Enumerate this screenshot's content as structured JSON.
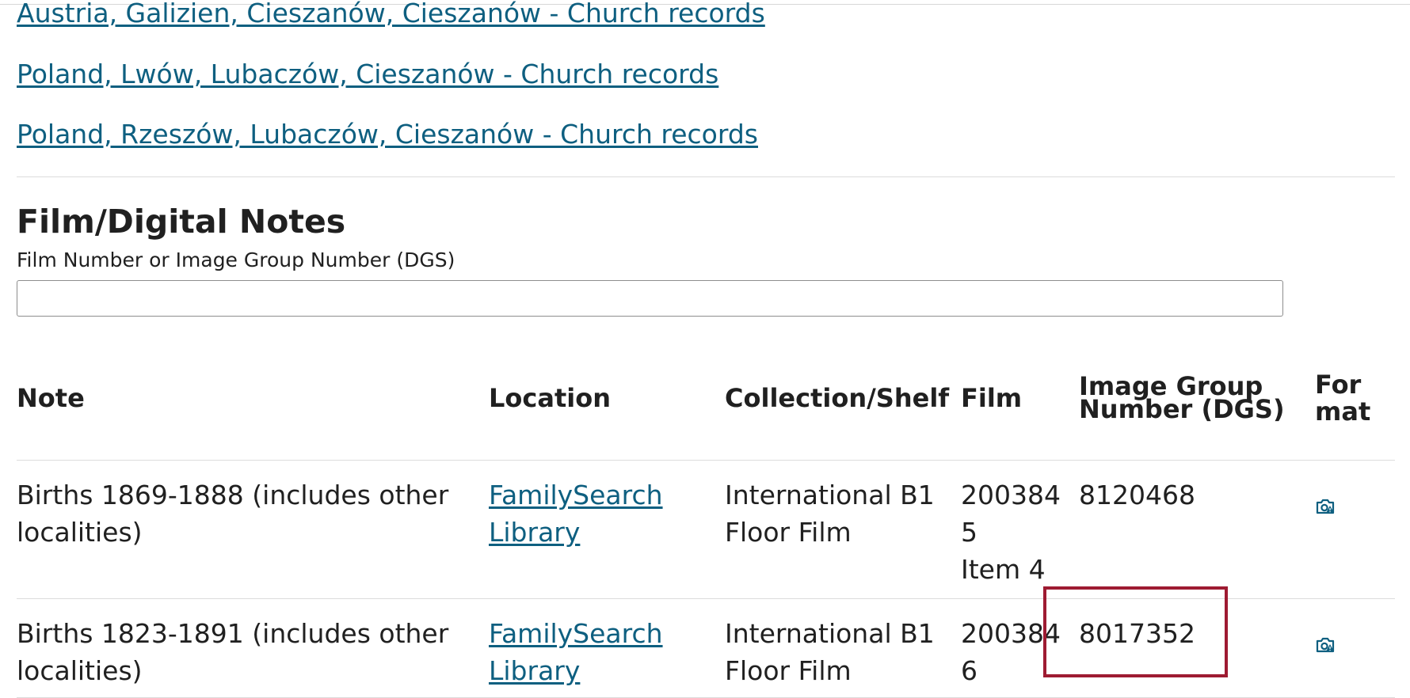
{
  "related_places": [
    {
      "label": "Austria, Galizien, Cieszanów, Cieszanów - Church records"
    },
    {
      "label": "Poland, Lwów, Lubaczów, Cieszanów - Church records"
    },
    {
      "label": "Poland, Rzeszów, Lubaczów, Cieszanów - Church records"
    }
  ],
  "film_notes": {
    "title": "Film/Digital Notes",
    "filter_label": "Film Number or Image Group Number (DGS)",
    "filter_value": "",
    "filter_placeholder": "",
    "columns": {
      "note": "Note",
      "location": "Location",
      "collection": "Collection/Shelf",
      "film": "Film",
      "dgs": "Image Group Number (DGS)",
      "format": "Format"
    },
    "rows": [
      {
        "note": "Births 1869-1888 (includes other localities)",
        "location": "FamilySearch Library",
        "collection": "International B1 Floor Film",
        "film": "2003845",
        "item": "Item 4",
        "dgs": "8120468",
        "format_icon": "camera-icon"
      },
      {
        "note": "Births 1823-1891 (includes other localities)",
        "location": "FamilySearch Library",
        "collection": "International B1 Floor Film",
        "film": "2003846",
        "item": "",
        "dgs": "8017352",
        "format_icon": "camera-icon"
      }
    ]
  },
  "colors": {
    "link": "#0e5f80",
    "text": "#202020",
    "highlight": "#9e1b32"
  }
}
